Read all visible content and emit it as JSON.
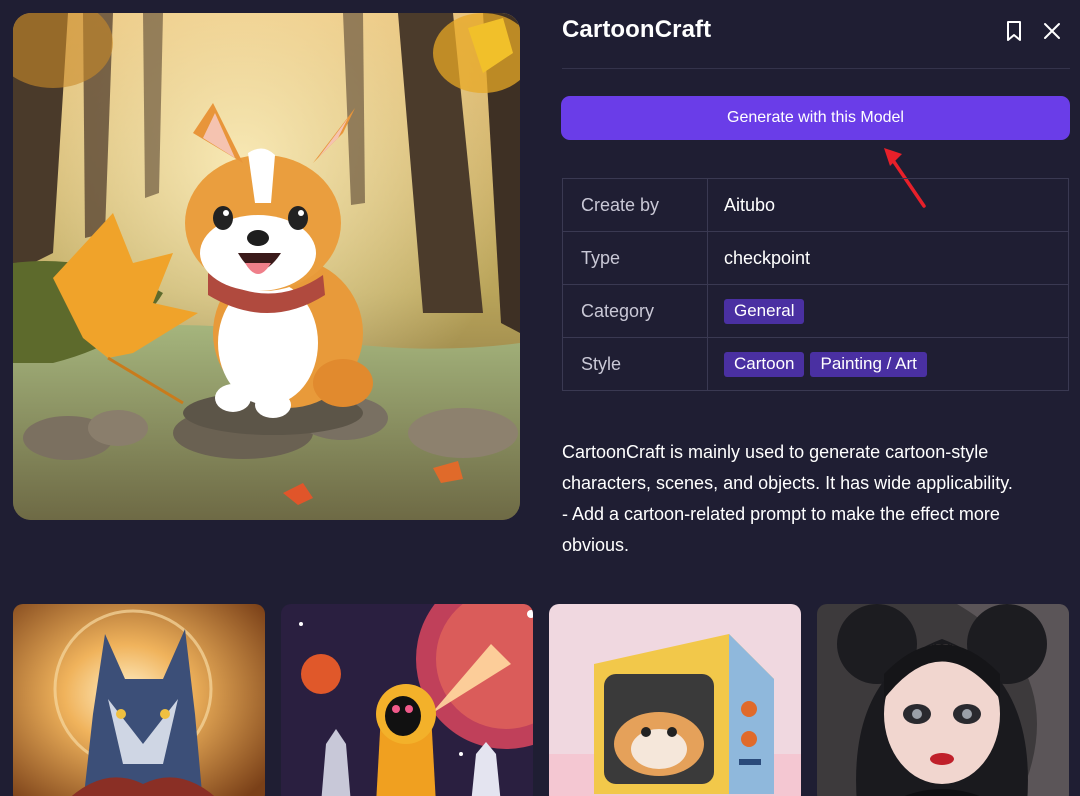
{
  "model": {
    "title": "CartoonCraft",
    "generate_label": "Generate with this Model"
  },
  "header_icons": [
    "bookmark-icon",
    "close-icon"
  ],
  "details": {
    "create_by": {
      "label": "Create by",
      "value": "Aitubo"
    },
    "type": {
      "label": "Type",
      "value": "checkpoint"
    },
    "category": {
      "label": "Category",
      "tags": [
        "General"
      ]
    },
    "style": {
      "label": "Style",
      "tags": [
        "Cartoon",
        "Painting / Art"
      ]
    }
  },
  "description": {
    "line1": "CartoonCraft is mainly used to generate cartoon-style characters, scenes, and objects. It has wide applicability.",
    "line2": "- Add a cartoon-related prompt to make the effect more obvious."
  },
  "colors": {
    "background": "#1f1e33",
    "accent": "#6a3de8",
    "tag": "#4a30a2",
    "annotation_arrow": "#e8202a"
  },
  "gallery": [
    "wolf-image",
    "astronaut-image",
    "hamster-tv-image",
    "gothic-girl-image"
  ]
}
